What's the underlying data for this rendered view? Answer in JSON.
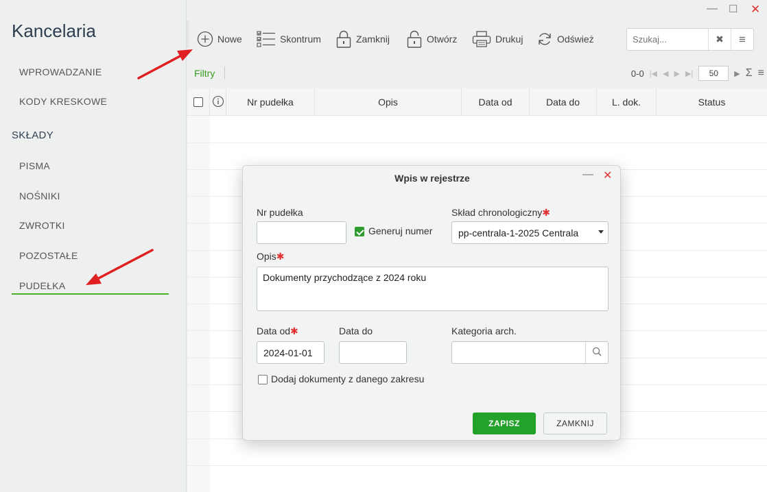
{
  "app": {
    "title": "Kancelaria"
  },
  "sidebar": {
    "items": [
      {
        "label": "WPROWADZANIE"
      },
      {
        "label": "KODY KRESKOWE"
      }
    ],
    "section": "SKŁADY",
    "sub_items": [
      {
        "label": "PISMA"
      },
      {
        "label": "NOŚNIKI"
      },
      {
        "label": "ZWROTKI"
      },
      {
        "label": "POZOSTAŁE"
      },
      {
        "label": "PUDEŁKA",
        "active": true
      }
    ]
  },
  "window": {
    "minimize": "—",
    "maximize": "☐",
    "close": "✕"
  },
  "toolbar": {
    "new_label": "Nowe",
    "skontrum_label": "Skontrum",
    "close_label": "Zamknij",
    "open_label": "Otwórz",
    "print_label": "Drukuj",
    "refresh_label": "Odśwież",
    "search_placeholder": "Szukaj...",
    "search_clear": "✖",
    "search_menu": "≡"
  },
  "filter_bar": {
    "filters_label": "Filtry",
    "range": "0-0",
    "page_size": "50",
    "sum_icon": "Σ",
    "menu_icon": "≡"
  },
  "grid": {
    "columns": [
      "Nr pudełka",
      "Opis",
      "Data od",
      "Data do",
      "L. dok.",
      "Status"
    ]
  },
  "dialog": {
    "title": "Wpis w rejestrze",
    "minimize": "—",
    "close": "✕",
    "nr_label": "Nr pudełka",
    "nr_value": "",
    "generate_label": "Generuj numer",
    "generate_checked": true,
    "sklad_label": "Skład chronologiczny",
    "sklad_value": "pp-centrala-1-2025 Centrala",
    "opis_label": "Opis",
    "opis_value": "Dokumenty przychodzące z 2024 roku",
    "data_od_label": "Data od",
    "data_od_value": "2024-01-01",
    "data_do_label": "Data do",
    "data_do_value": "",
    "kategoria_label": "Kategoria arch.",
    "kategoria_value": "",
    "add_docs_label": "Dodaj dokumenty z danego zakresu",
    "add_docs_checked": false,
    "save_label": "ZAPISZ",
    "cancel_label": "ZAMKNIJ",
    "required_mark": "✱"
  },
  "colors": {
    "accent_green": "#3a9a1e",
    "save_green": "#22a22a",
    "required_red": "#e03232",
    "arrow_red": "#e02020"
  }
}
